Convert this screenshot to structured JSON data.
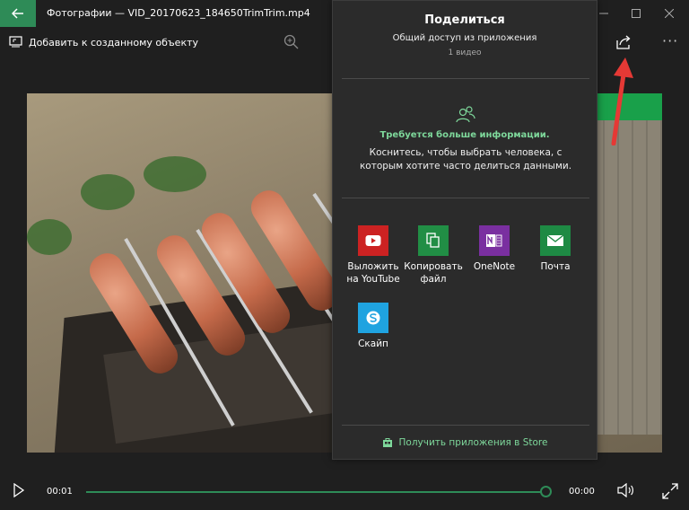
{
  "window": {
    "title": "Фотографии — VID_20170623_184650TrimTrim.mp4",
    "accent": "#2e8b57"
  },
  "toolbar": {
    "add_to_label": "Добавить к созданному объекту",
    "icons": [
      "add-to-creation-icon",
      "zoom-icon",
      "share-icon",
      "more-icon"
    ]
  },
  "share_panel": {
    "title": "Поделиться",
    "subtitle": "Общий доступ из приложения",
    "count": "1 видео",
    "people_heading": "Требуется больше информации.",
    "people_hint": "Коснитесь, чтобы выбрать человека, с которым хотите часто делиться данными.",
    "apps": [
      {
        "label": "Выложить на YouTube",
        "color": "#cc2222",
        "icon": "youtube-icon"
      },
      {
        "label": "Копировать файл",
        "color": "#218e45",
        "icon": "copy-file-icon"
      },
      {
        "label": "OneNote",
        "color": "#7a2fa0",
        "icon": "onenote-icon"
      },
      {
        "label": "Почта",
        "color": "#1e8a44",
        "icon": "mail-icon"
      },
      {
        "label": "Скайп",
        "color": "#1fa3e0",
        "icon": "skype-icon"
      }
    ],
    "store_link": "Получить приложения в Store",
    "accent": "#7ed89b"
  },
  "player": {
    "current_time": "00:01",
    "end_time": "00:00",
    "progress": 1.0
  }
}
